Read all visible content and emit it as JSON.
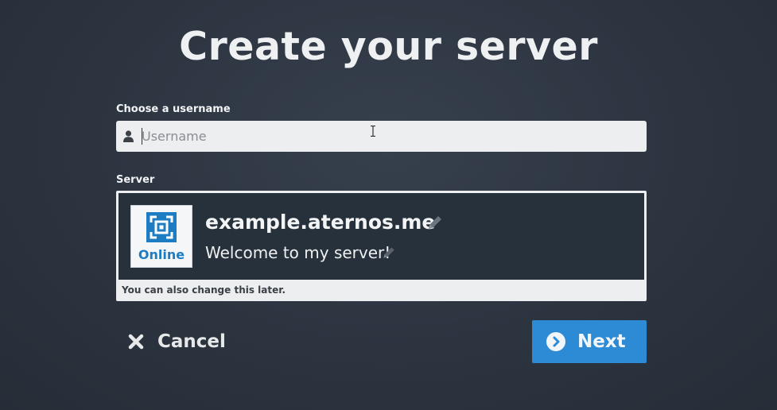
{
  "page": {
    "title": "Create your server"
  },
  "username": {
    "label": "Choose a username",
    "placeholder": "Username",
    "value": ""
  },
  "server": {
    "label": "Server",
    "status": "Online",
    "address": "example.aternos.me",
    "motd": "Welcome to my server!",
    "note": "You can also change this later."
  },
  "actions": {
    "cancel_label": "Cancel",
    "next_label": "Next"
  },
  "icons": {
    "username": "user-icon",
    "server_logo": "aternos-logo-icon",
    "edit": "pencil-icon",
    "cancel": "close-icon",
    "next": "chevron-right-circle-icon"
  },
  "colors": {
    "background": "#2c3440",
    "primary": "#2d8bd6",
    "status_online": "#1e7cc2",
    "input_background": "#eceeef",
    "server_card": "#27313b"
  }
}
